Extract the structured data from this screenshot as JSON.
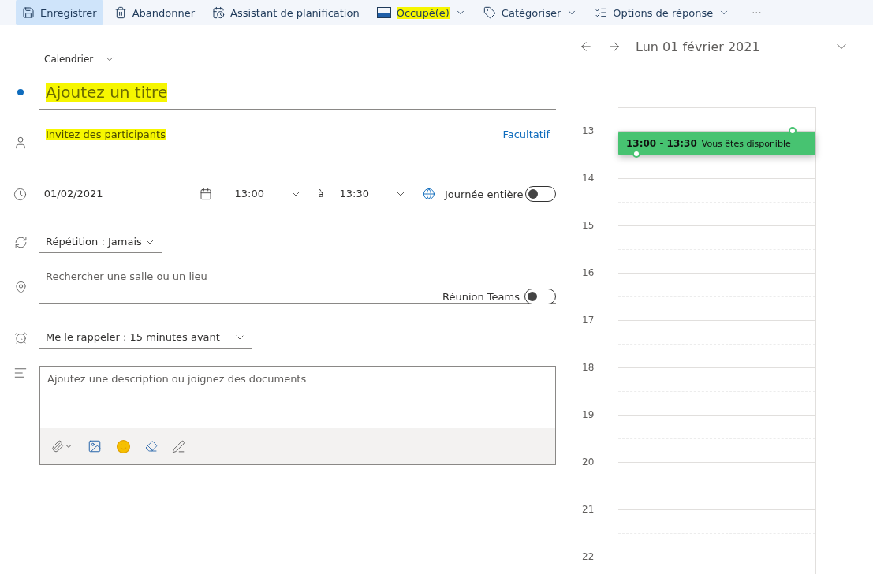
{
  "toolbar": {
    "items": [
      {
        "label": "Enregistrer",
        "selected": true,
        "dropdown": false,
        "highlighted": false
      },
      {
        "label": "Abandonner",
        "selected": false,
        "dropdown": false,
        "highlighted": false
      },
      {
        "label": "Assistant de planification",
        "selected": false,
        "dropdown": false,
        "highlighted": false
      },
      {
        "label": "Occupé(e)",
        "selected": false,
        "dropdown": true,
        "highlighted": true
      },
      {
        "label": "Catégoriser",
        "selected": false,
        "dropdown": true,
        "highlighted": false
      },
      {
        "label": "Options de réponse",
        "selected": false,
        "dropdown": true,
        "highlighted": false
      }
    ],
    "overflow": "···"
  },
  "form": {
    "calendar_picker": "Calendrier",
    "title": {
      "placeholder": "Ajoutez un titre",
      "highlighted": true
    },
    "participants": {
      "placeholder": "Invitez des participants",
      "highlighted": true,
      "optional_link": "Facultatif"
    },
    "date": "01/02/2021",
    "start_time": "13:00",
    "separator": "à",
    "end_time": "13:30",
    "all_day": {
      "label": "Journée entière",
      "on": false
    },
    "repeat": "Répétition :  Jamais",
    "location": {
      "placeholder": "Rechercher une salle ou un lieu"
    },
    "teams": {
      "label": "Réunion Teams",
      "on": false
    },
    "reminder": "Me le rappeler :  15 minutes avant",
    "description": {
      "placeholder": "Ajoutez une description ou joignez des documents"
    }
  },
  "calendar": {
    "date_label": "Lun 01 février 2021",
    "hours": [
      "13",
      "14",
      "15",
      "16",
      "17",
      "18",
      "19",
      "20",
      "21",
      "22"
    ],
    "event": {
      "time": "13:00 - 13:30",
      "label": "Vous êtes disponible"
    }
  }
}
